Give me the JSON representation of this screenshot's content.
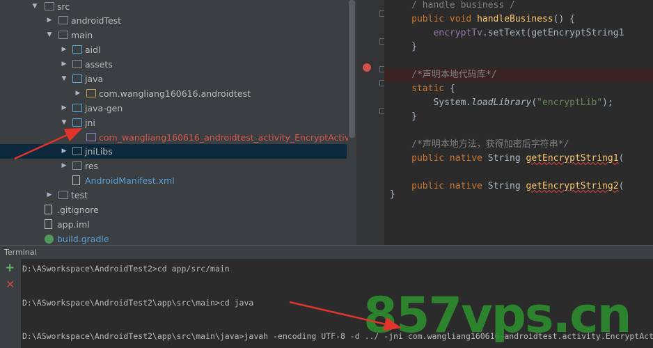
{
  "project_tree": {
    "items": [
      {
        "label": "src",
        "arrow": "▼",
        "icon": "folder",
        "state": ""
      },
      {
        "label": "androidTest",
        "arrow": "▶",
        "icon": "folder",
        "state": ""
      },
      {
        "label": "main",
        "arrow": "▼",
        "icon": "folder",
        "state": ""
      },
      {
        "label": "aidl",
        "arrow": "▶",
        "icon": "folder-blue",
        "state": ""
      },
      {
        "label": "assets",
        "arrow": "▶",
        "icon": "folder",
        "state": ""
      },
      {
        "label": "java",
        "arrow": "▼",
        "icon": "folder-blue",
        "state": ""
      },
      {
        "label": "com.wangliang160616.androidtest",
        "arrow": "▶",
        "icon": "package",
        "state": ""
      },
      {
        "label": "java-gen",
        "arrow": "▶",
        "icon": "folder-blue",
        "state": ""
      },
      {
        "label": "jni",
        "arrow": "▼",
        "icon": "folder-blue",
        "state": ""
      },
      {
        "label": "com_wangliang160616_androidtest_activity_EncryptActivity.h",
        "arrow": "",
        "icon": "c-header",
        "state": "error"
      },
      {
        "label": "jniLibs",
        "arrow": "▶",
        "icon": "folder",
        "state": "selected"
      },
      {
        "label": "res",
        "arrow": "▶",
        "icon": "folder",
        "state": ""
      },
      {
        "label": "AndroidManifest.xml",
        "arrow": "",
        "icon": "xml-file",
        "state": "link"
      },
      {
        "label": "test",
        "arrow": "▶",
        "icon": "folder",
        "state": ""
      },
      {
        "label": ".gitignore",
        "arrow": "",
        "icon": "file",
        "state": ""
      },
      {
        "label": "app.iml",
        "arrow": "",
        "icon": "file",
        "state": ""
      },
      {
        "label": "build.gradle",
        "arrow": "",
        "icon": "gradle",
        "state": "link"
      }
    ]
  },
  "editor": {
    "lines": [
      {
        "id": "l0",
        "indent": "    ",
        "segments": [
          {
            "cls": "cm",
            "text": "/ handle business /"
          }
        ]
      },
      {
        "id": "l1",
        "indent": "    ",
        "segments": [
          {
            "cls": "kw",
            "text": "public void "
          },
          {
            "cls": "fn",
            "text": "handleBusiness"
          },
          {
            "cls": "",
            "text": "() {"
          }
        ]
      },
      {
        "id": "l2",
        "indent": "        ",
        "segments": [
          {
            "cls": "fld",
            "text": "encryptTv"
          },
          {
            "cls": "",
            "text": ".setText(getEncryptString1"
          }
        ]
      },
      {
        "id": "l3",
        "indent": "    ",
        "segments": [
          {
            "cls": "",
            "text": "}"
          }
        ]
      },
      {
        "id": "l4",
        "indent": "",
        "segments": []
      },
      {
        "id": "l5",
        "indent": "    ",
        "segments": [
          {
            "cls": "cm",
            "text": "/*声明本地代码库*/"
          }
        ]
      },
      {
        "id": "l6",
        "indent": "    ",
        "segments": [
          {
            "cls": "kw",
            "text": "static "
          },
          {
            "cls": "",
            "text": "{"
          }
        ]
      },
      {
        "id": "l7",
        "indent": "        ",
        "segments": [
          {
            "cls": "",
            "text": "System."
          },
          {
            "cls": "it",
            "text": "loadLibrary"
          },
          {
            "cls": "",
            "text": "("
          },
          {
            "cls": "str",
            "text": "\"encryptLib\""
          },
          {
            "cls": "",
            "text": ");"
          }
        ]
      },
      {
        "id": "l8",
        "indent": "    ",
        "segments": [
          {
            "cls": "",
            "text": "}"
          }
        ]
      },
      {
        "id": "l9",
        "indent": "",
        "segments": []
      },
      {
        "id": "l10",
        "indent": "    ",
        "segments": [
          {
            "cls": "cm",
            "text": "/*声明本地方法，获得加密后字符串*/"
          }
        ]
      },
      {
        "id": "l11",
        "indent": "    ",
        "segments": [
          {
            "cls": "kw",
            "text": "public native "
          },
          {
            "cls": "",
            "text": "String "
          },
          {
            "cls": "err",
            "text": "getEncryptString1"
          },
          {
            "cls": "",
            "text": "("
          }
        ]
      },
      {
        "id": "l12",
        "indent": "",
        "segments": []
      },
      {
        "id": "l13",
        "indent": "    ",
        "segments": [
          {
            "cls": "kw",
            "text": "public native "
          },
          {
            "cls": "",
            "text": "String "
          },
          {
            "cls": "err",
            "text": "getEncryptString2"
          },
          {
            "cls": "",
            "text": "("
          }
        ]
      },
      {
        "id": "l14",
        "indent": "",
        "segments": []
      },
      {
        "id": "l15",
        "indent": "",
        "segments": [
          {
            "cls": "",
            "text": "}"
          }
        ]
      }
    ]
  },
  "terminal": {
    "title": "Terminal",
    "new_session_symbol": "+",
    "close_symbol": "✕",
    "lines": [
      "D:\\ASworkspace\\AndroidTest2>cd app/src/main",
      "D:\\ASworkspace\\AndroidTest2\\app\\src\\main>cd java",
      "D:\\ASworkspace\\AndroidTest2\\app\\src\\main\\java>javah -encoding UTF-8 -d ../ -jni com.wangliang160616.androidtest.activity.EncryptAct"
    ]
  },
  "watermark": {
    "text": "857vps.cn"
  },
  "colors": {
    "keyword": "#cc7832",
    "function": "#ffc66d",
    "comment": "#808080",
    "string": "#6a8759",
    "field": "#9876aa",
    "error_file": "#d2574f",
    "link": "#5a9fd6",
    "annotation_arrow": "#e0342c",
    "watermark": "#2e8b2e"
  }
}
